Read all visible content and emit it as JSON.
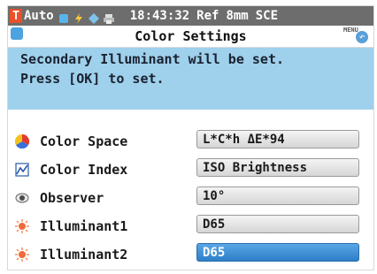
{
  "status": {
    "badge": "T",
    "auto": "Auto",
    "time": "18:43:32",
    "ref": "Ref",
    "aperture": "8mm",
    "mode": "SCE"
  },
  "header": {
    "title": "Color Settings",
    "menu_label": "MENU"
  },
  "message": {
    "line1": "Secondary Illuminant will be set.",
    "line2": "Press [OK] to set."
  },
  "settings": [
    {
      "label": "Color Space",
      "value": "L*C*h ΔE*94",
      "icon": "color-space-icon"
    },
    {
      "label": "Color Index",
      "value": "ISO Brightness",
      "icon": "color-index-icon"
    },
    {
      "label": "Observer",
      "value": "10°",
      "icon": "observer-eye-icon"
    },
    {
      "label": "Illuminant1",
      "value": "D65",
      "icon": "illuminant1-sun-icon"
    },
    {
      "label": "Illuminant2",
      "value": "D65",
      "icon": "illuminant2-sun-icon"
    }
  ],
  "colors": {
    "message_bg": "#9fd0ec",
    "selected_value_bg": "#3c8fd6",
    "status_bar_bg": "#6d6d6d"
  }
}
